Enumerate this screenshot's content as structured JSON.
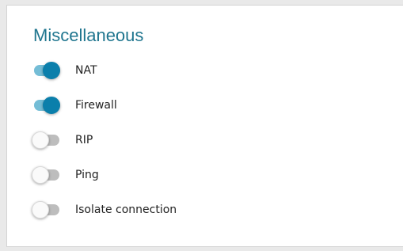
{
  "section": {
    "title": "Miscellaneous",
    "toggles": [
      {
        "label": "NAT",
        "checked": true
      },
      {
        "label": "Firewall",
        "checked": true
      },
      {
        "label": "RIP",
        "checked": false
      },
      {
        "label": "Ping",
        "checked": false
      },
      {
        "label": "Isolate connection",
        "checked": false
      }
    ]
  },
  "colors": {
    "title": "#20768f",
    "toggle_on_thumb": "#0b7fab",
    "toggle_on_track": "#74bdd6",
    "toggle_off_thumb": "#fafafa",
    "toggle_off_track": "#bdbdbd"
  }
}
